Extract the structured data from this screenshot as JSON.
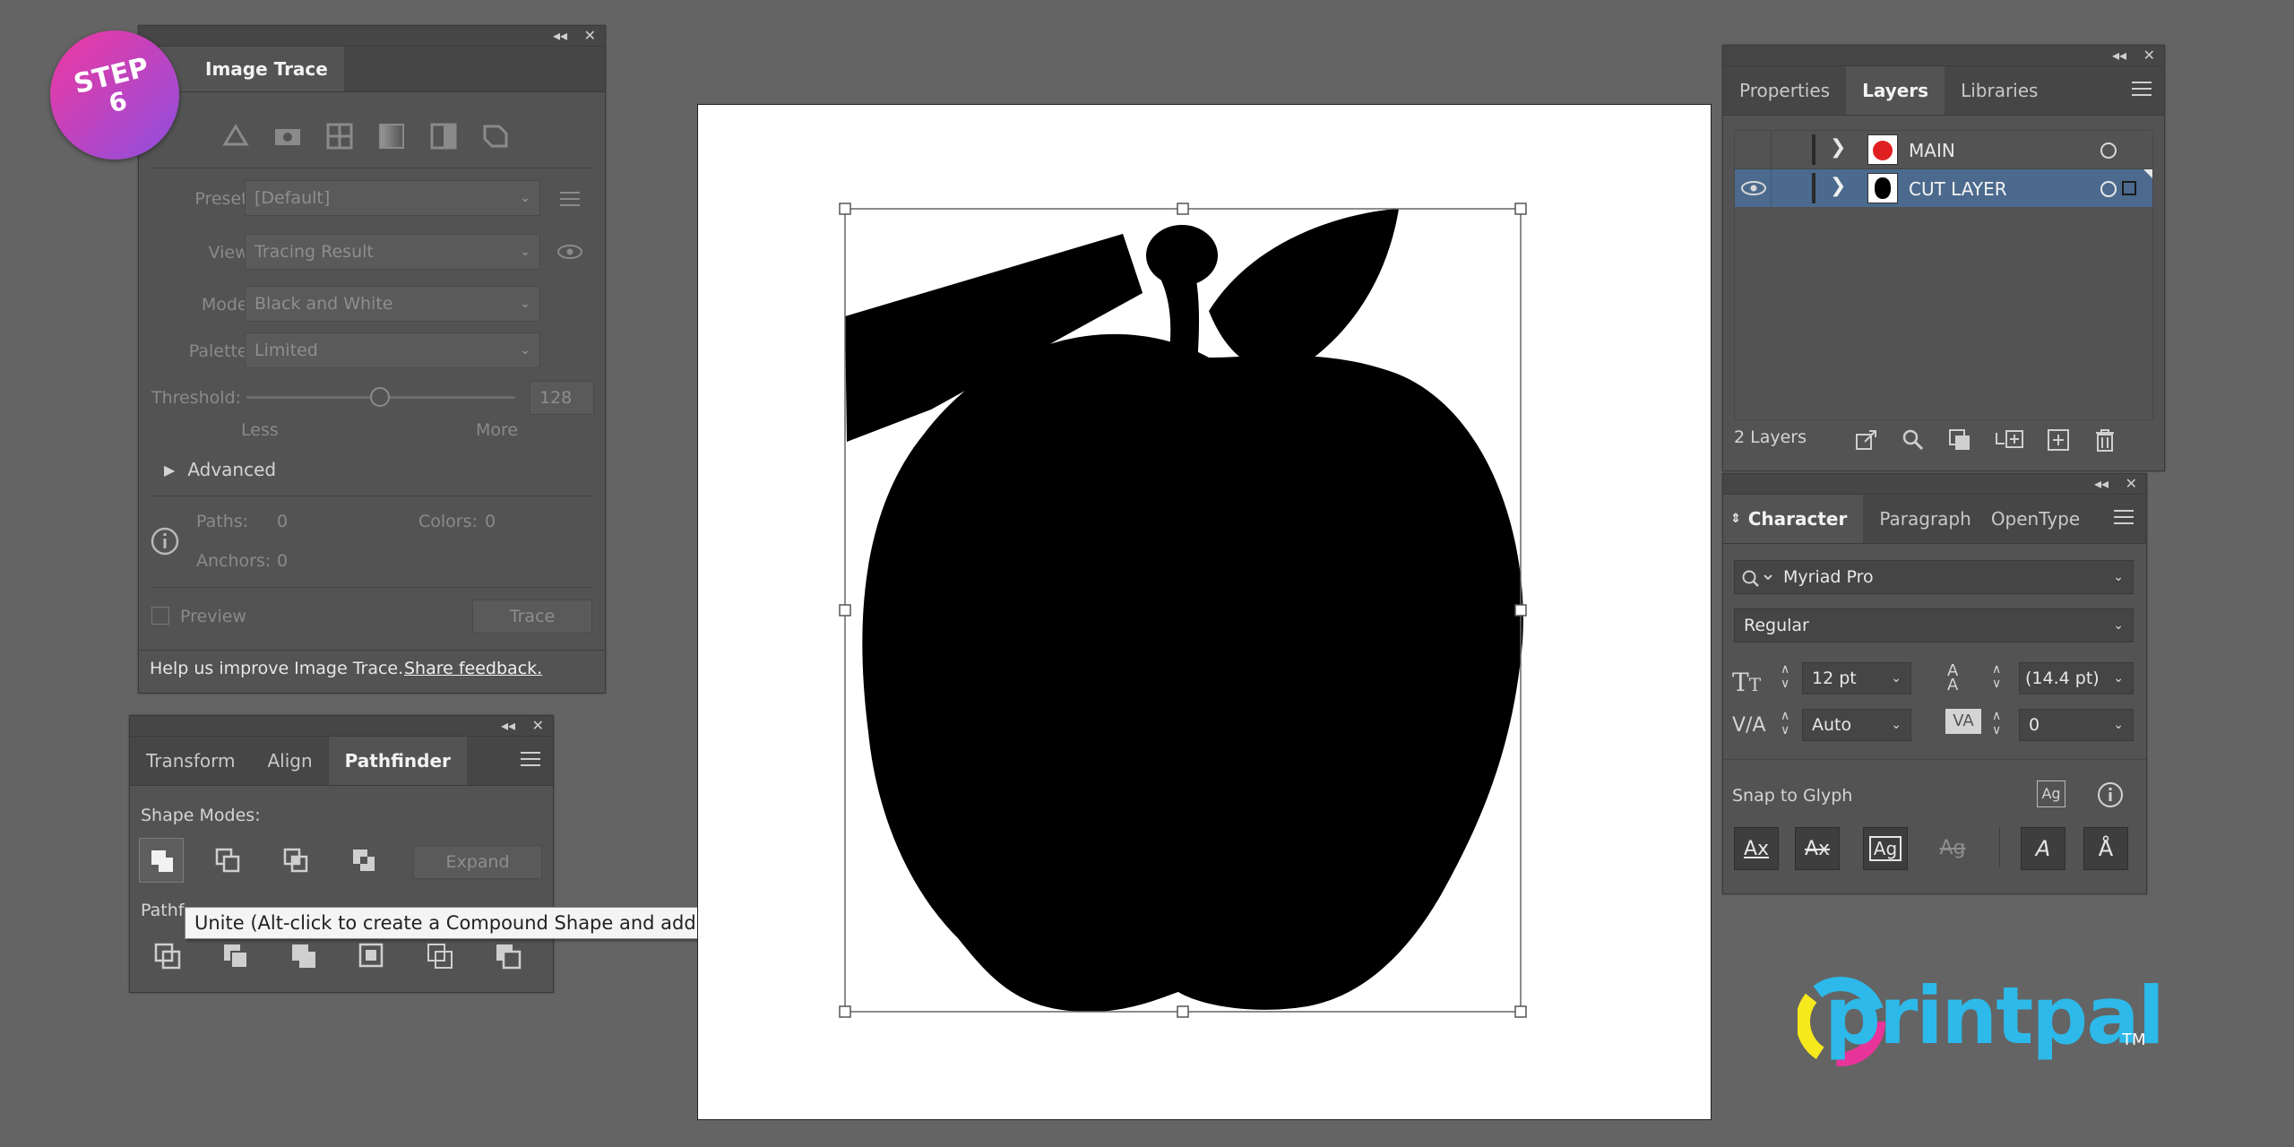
{
  "badge": {
    "line1": "STEP",
    "line2": "6"
  },
  "image_trace": {
    "tab_label": "Image Trace",
    "preset_label": "Preset:",
    "preset_value": "[Default]",
    "view_label": "View:",
    "view_value": "Tracing Result",
    "mode_label": "Mode:",
    "mode_value": "Black and White",
    "palette_label": "Palette:",
    "palette_value": "Limited",
    "threshold_label": "Threshold:",
    "threshold_value": "128",
    "less_label": "Less",
    "more_label": "More",
    "advanced_label": "Advanced",
    "paths_label": "Paths:",
    "paths_value": "0",
    "colors_label": "Colors:",
    "colors_value": "0",
    "anchors_label": "Anchors:",
    "anchors_value": "0",
    "preview_label": "Preview",
    "trace_label": "Trace",
    "help_text": "Help us improve Image Trace.",
    "feedback_link": "Share feedback."
  },
  "pathfinder": {
    "tabs": [
      "Transform",
      "Align",
      "Pathfinder"
    ],
    "shape_modes_label": "Shape Modes:",
    "expand_label": "Expand",
    "pathfinders_label": "Pathf",
    "tooltip": "Unite (Alt-click to create a Compound Shape and add to shape area)"
  },
  "layers": {
    "tabs": [
      "Properties",
      "Layers",
      "Libraries"
    ],
    "items": [
      {
        "name": "MAIN"
      },
      {
        "name": "CUT LAYER"
      }
    ],
    "count_label": "2 Layers"
  },
  "character": {
    "tabs": [
      "Character",
      "Paragraph",
      "OpenType"
    ],
    "font_family": "Myriad Pro",
    "font_style": "Regular",
    "font_size": "12 pt",
    "leading": "(14.4 pt)",
    "kerning": "Auto",
    "tracking": "0",
    "snap_label": "Snap to Glyph",
    "glyph_buttons": [
      "Ax",
      "Ax",
      "Ag",
      "Ag"
    ]
  },
  "logo": {
    "text": "printpal",
    "tm": "TM"
  },
  "colors": {
    "selection_blue": "#4b6a8e",
    "accent": "#2db9ea",
    "badge_from": "#f0389f",
    "badge_to": "#8d4fe0"
  }
}
